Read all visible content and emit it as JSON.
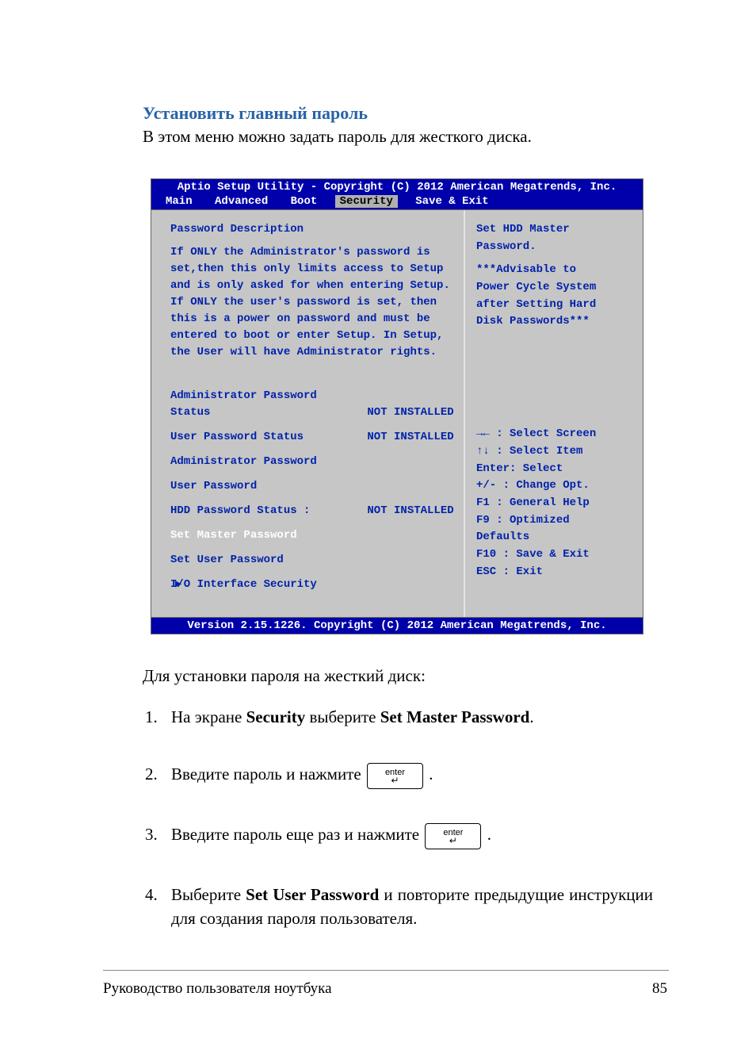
{
  "section_title": "Установить главный пароль",
  "intro": "В этом меню можно задать пароль для жесткого диска.",
  "bios": {
    "top": "Aptio Setup Utility - Copyright (C) 2012 American Megatrends, Inc.",
    "tabs": {
      "main": "Main",
      "advanced": "Advanced",
      "boot": "Boot",
      "security": "Security",
      "save_exit": "Save & Exit"
    },
    "left": {
      "header": "Password Description",
      "desc_lines": [
        "If ONLY the Administrator's password is",
        "set,then this only limits access to Setup",
        "and is only asked for when entering Setup.",
        "If ONLY the user's password is set, then",
        "this is a power on password and must be",
        "entered to boot or enter Setup. In Setup,",
        "the User will have Administrator rights."
      ],
      "admin_pw_status_label": "Administrator Password Status",
      "admin_pw_status_value": "NOT INSTALLED",
      "user_pw_status_label": "User Password Status",
      "user_pw_status_value": "NOT INSTALLED",
      "admin_pw": "Administrator Password",
      "user_pw": "User Password",
      "hdd_pw_status_label": "HDD Password Status :",
      "hdd_pw_status_value": "NOT INSTALLED",
      "set_master_pw": "Set Master Password",
      "set_user_pw": "Set User Password",
      "io_interface": "I/O Interface Security"
    },
    "right_help": {
      "l1": "Set HDD Master",
      "l2": "Password.",
      "l3": "***Advisable to",
      "l4": "Power Cycle System",
      "l5": "after Setting Hard",
      "l6": "Disk Passwords***"
    },
    "right_nav": {
      "l1": "→←  : Select Screen",
      "l2": "↑↓  : Select Item",
      "l3": "Enter: Select",
      "l4": "+/-  : Change Opt.",
      "l5": "F1   : General Help",
      "l6": "F9   : Optimized",
      "l7": "Defaults",
      "l8": "F10  : Save & Exit",
      "l9": "ESC  : Exit"
    },
    "footer": "Version 2.15.1226. Copyright (C) 2012 American Megatrends, Inc."
  },
  "subhead": "Для установки пароля на жесткий диск:",
  "steps": {
    "s1_a": "На экране ",
    "s1_b": "Security",
    "s1_c": " выберите ",
    "s1_d": "Set Master Password",
    "s1_e": ".",
    "s2": "Введите пароль и нажмите ",
    "s3": "Введите пароль еще раз и нажмите ",
    "s4_a": "Выберите ",
    "s4_b": "Set User Password",
    "s4_c": " и повторите предыдущие инструкции для создания пароля пользователя."
  },
  "enter_key_label": "enter",
  "enter_key_glyph": "↵",
  "footer_left": "Руководство пользователя ноутбука",
  "footer_right": "85"
}
